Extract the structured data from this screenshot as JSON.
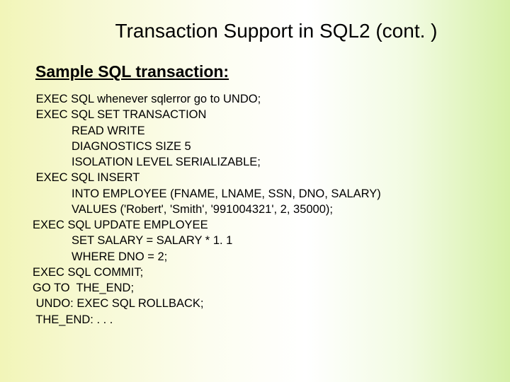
{
  "title": "Transaction Support in SQL2 (cont. )",
  "subtitle": "Sample SQL transaction:",
  "lines": [
    " EXEC SQL whenever sqlerror go to UNDO;",
    " EXEC SQL SET TRANSACTION",
    "            READ WRITE",
    "            DIAGNOSTICS SIZE 5",
    "            ISOLATION LEVEL SERIALIZABLE;",
    " EXEC SQL INSERT",
    "            INTO EMPLOYEE (FNAME, LNAME, SSN, DNO, SALARY)",
    "            VALUES ('Robert', 'Smith', '991004321', 2, 35000);",
    "EXEC SQL UPDATE EMPLOYEE",
    "            SET SALARY = SALARY * 1. 1",
    "            WHERE DNO = 2;",
    "EXEC SQL COMMIT;",
    "GO TO  THE_END;",
    " UNDO: EXEC SQL ROLLBACK;",
    " THE_END: . . ."
  ]
}
